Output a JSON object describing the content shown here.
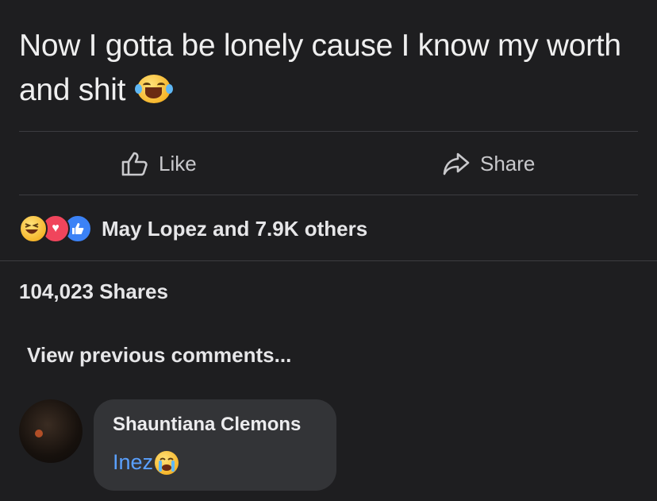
{
  "post": {
    "text": "Now I gotta be lonely cause I know my worth and shit",
    "emoji": "laughing-tears-emoji"
  },
  "actions": {
    "like_label": "Like",
    "share_label": "Share"
  },
  "reactions": {
    "icons": [
      "haha-reaction-icon",
      "love-reaction-icon",
      "like-reaction-icon"
    ],
    "summary": "May Lopez and 7.9K others"
  },
  "shares": {
    "text": "104,023 Shares"
  },
  "comments": {
    "view_previous": "View previous comments...",
    "items": [
      {
        "author": "Shauntiana Clemons",
        "text": "Inez",
        "emoji": "crying-emoji"
      }
    ]
  },
  "colors": {
    "background": "#1e1e20",
    "bubble": "#333437",
    "mention": "#5aa0ff"
  }
}
